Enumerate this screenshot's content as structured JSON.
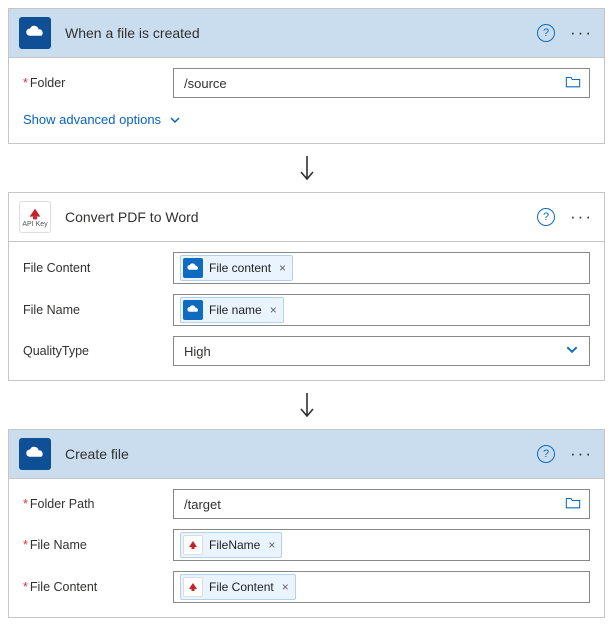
{
  "step1": {
    "title": "When a file is created",
    "fields": {
      "folder": {
        "label": "Folder",
        "value": "/source"
      }
    },
    "advanced": "Show advanced options"
  },
  "step2": {
    "title": "Convert PDF to Word",
    "iconCaption": "API Key",
    "fields": {
      "fileContent": {
        "label": "File Content",
        "token": "File content"
      },
      "fileName": {
        "label": "File Name",
        "token": "File name"
      },
      "qualityType": {
        "label": "QualityType",
        "value": "High"
      }
    }
  },
  "step3": {
    "title": "Create file",
    "fields": {
      "folderPath": {
        "label": "Folder Path",
        "value": "/target"
      },
      "fileName": {
        "label": "File Name",
        "token": "FileName"
      },
      "fileContent": {
        "label": "File Content",
        "token": "File Content"
      }
    }
  }
}
